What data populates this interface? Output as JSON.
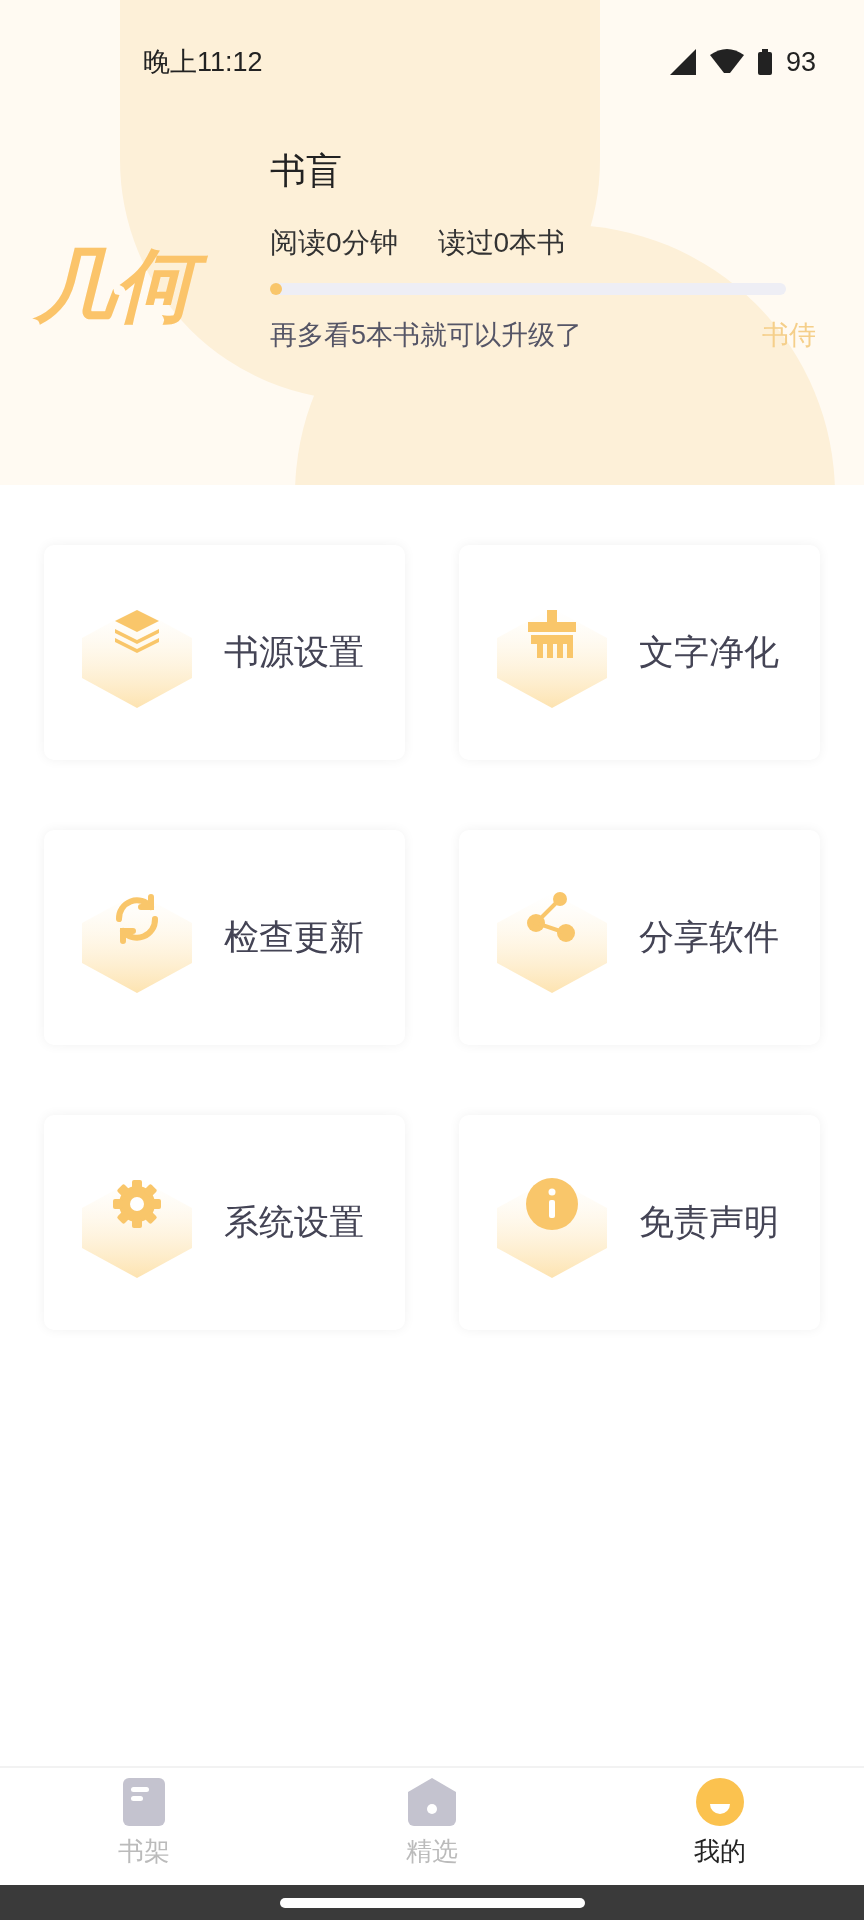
{
  "status_bar": {
    "time": "晚上11:12",
    "battery": "93"
  },
  "profile": {
    "logo": "几何",
    "name": "书盲",
    "stats": [
      "阅读0分钟",
      "读过0本书"
    ],
    "progress": {
      "level": 0
    },
    "hint": "再多看5本书就可以升级了",
    "next_rank": "书侍"
  },
  "menu": [
    {
      "label": "书源设置"
    },
    {
      "label": "文字净化"
    },
    {
      "label": "检查更新"
    },
    {
      "label": "分享软件"
    },
    {
      "label": "系统设置"
    },
    {
      "label": "免责声明"
    }
  ],
  "tabs": [
    {
      "label": "书架",
      "selected": false
    },
    {
      "label": "精选",
      "selected": false
    },
    {
      "label": "我的",
      "selected": true
    }
  ]
}
